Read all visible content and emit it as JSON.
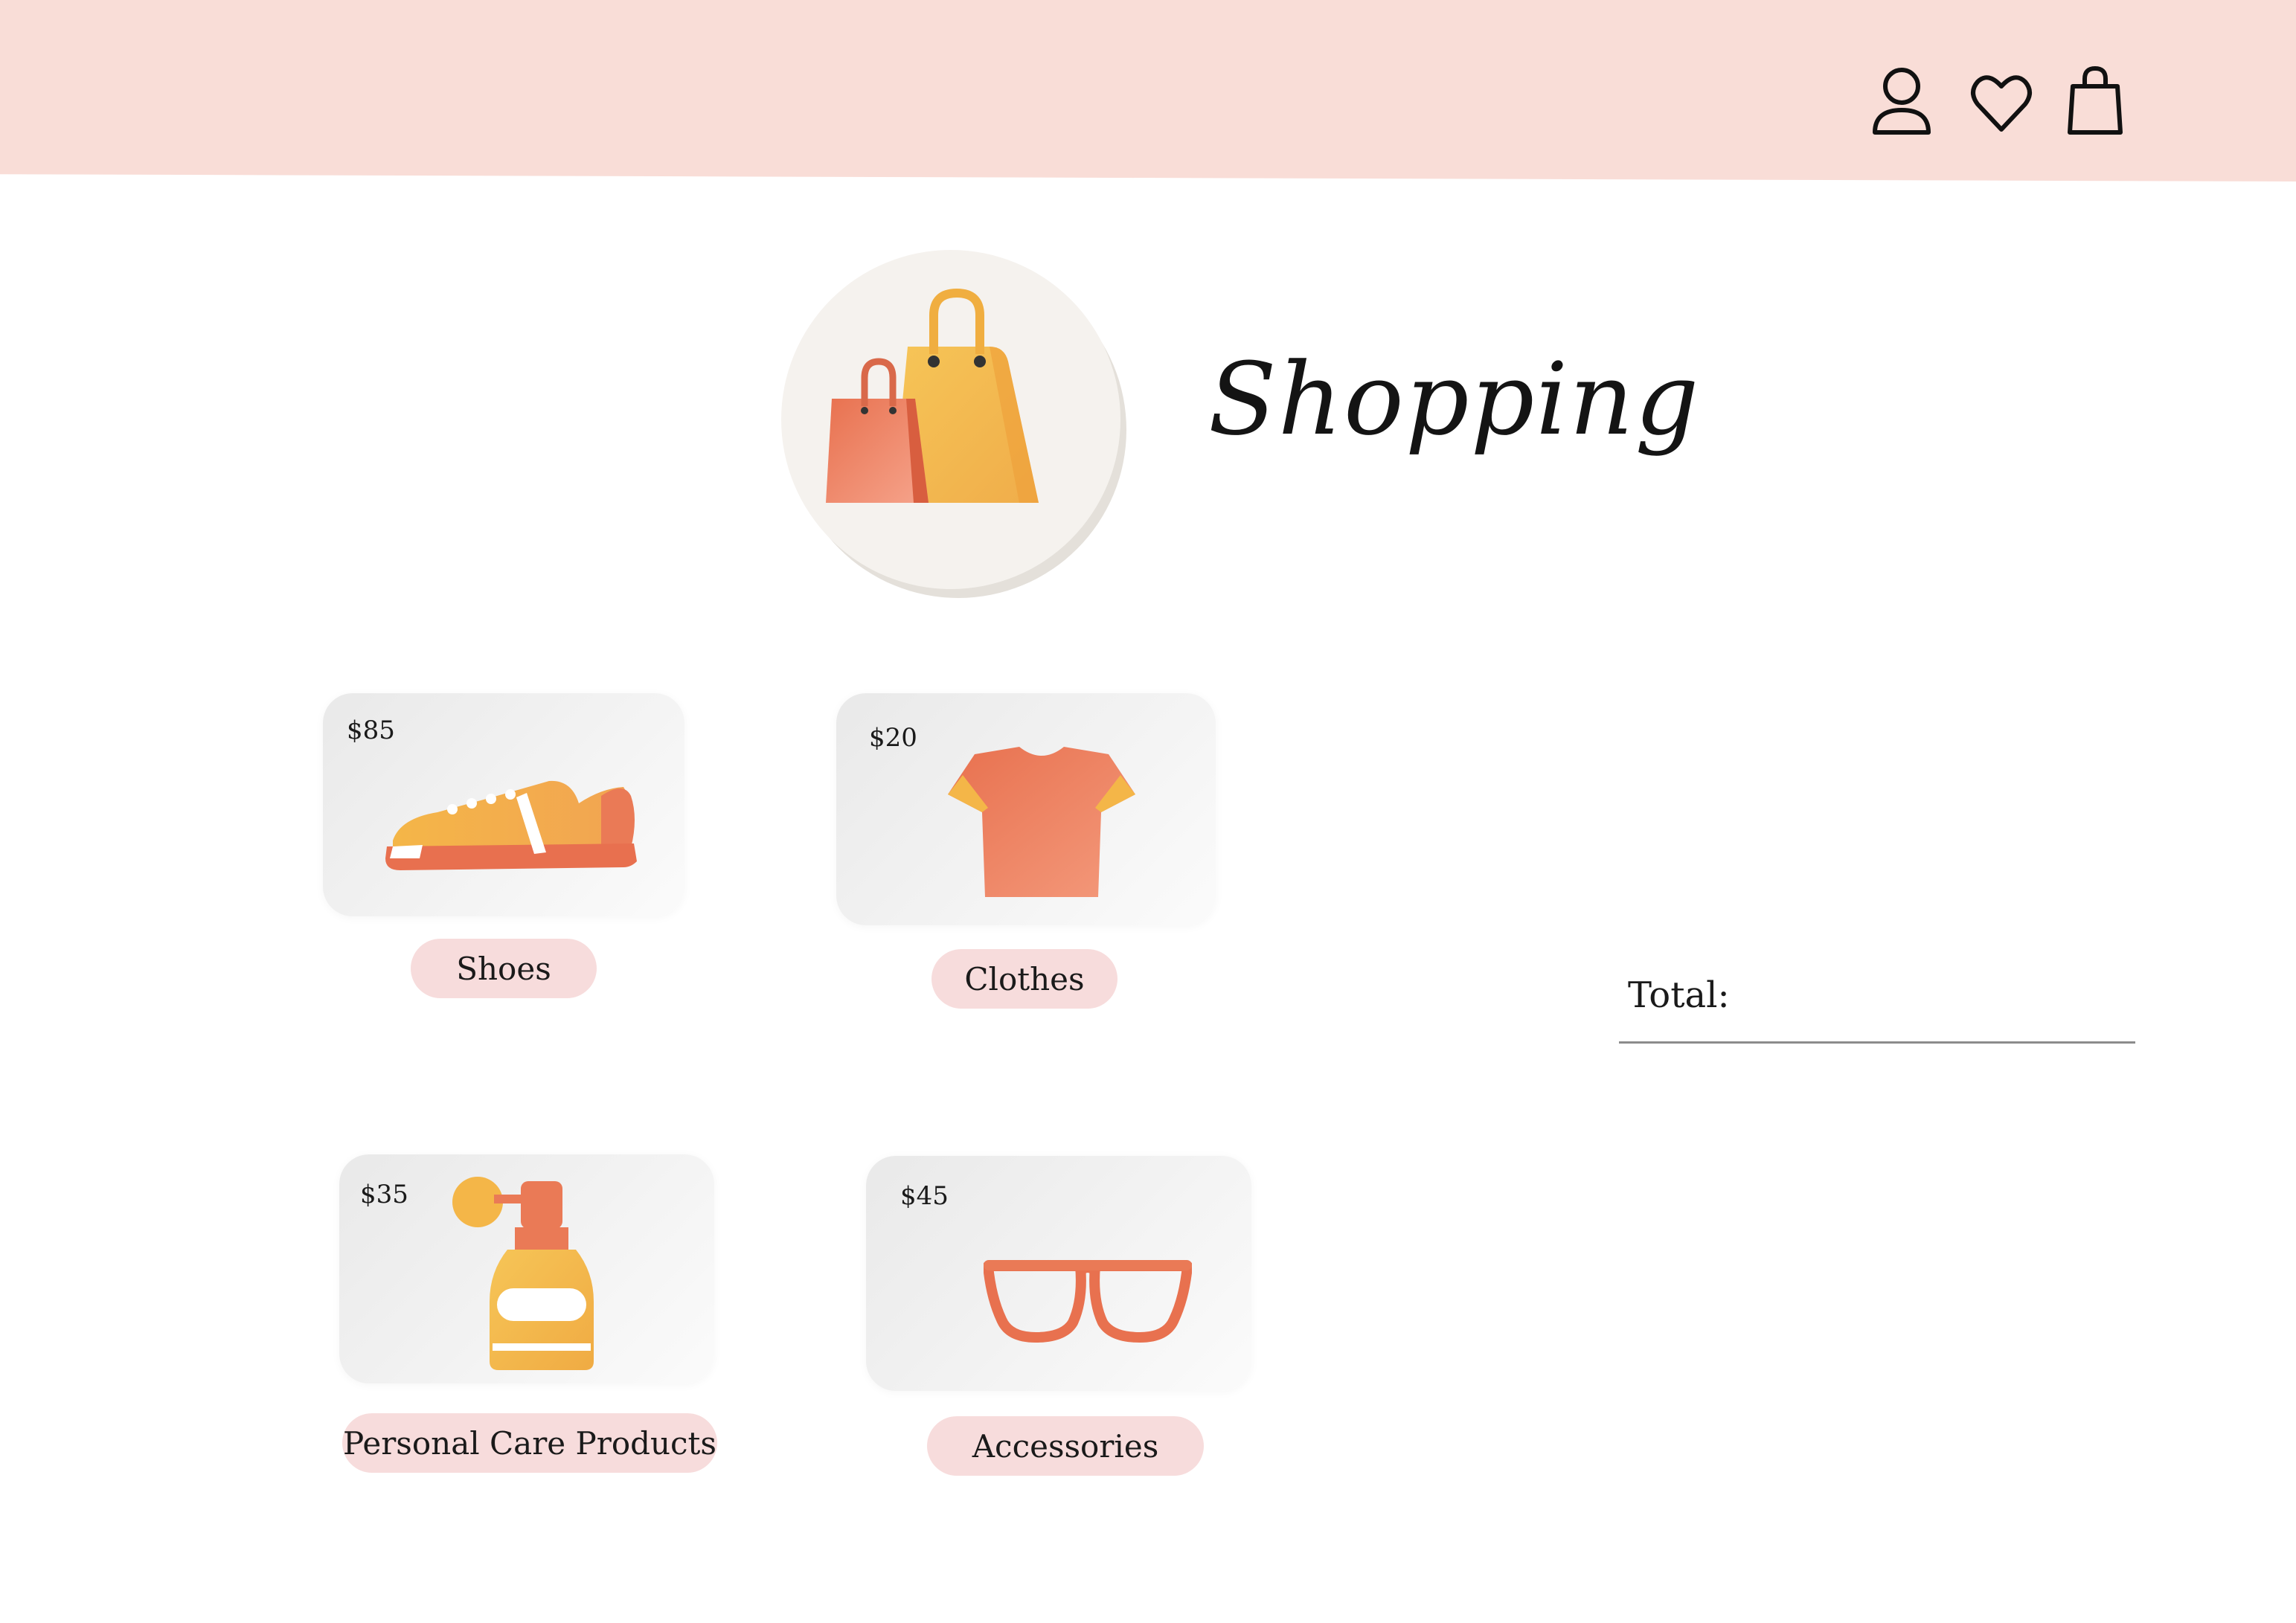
{
  "header": {
    "icons": [
      {
        "name": "user-icon"
      },
      {
        "name": "heart-icon"
      },
      {
        "name": "shopping-bag-icon"
      }
    ]
  },
  "hero": {
    "title": "Shopping",
    "logo_icon": "shopping-bags-icon"
  },
  "products": [
    {
      "price": "$85",
      "label": "Shoes",
      "icon": "sneaker-icon"
    },
    {
      "price": "$20",
      "label": "Clothes",
      "icon": "tshirt-icon"
    },
    {
      "price": "$35",
      "label": "Personal Care Products",
      "icon": "lotion-bottle-icon"
    },
    {
      "price": "$45",
      "label": "Accessories",
      "icon": "glasses-icon"
    }
  ],
  "summary": {
    "total_label": "Total:"
  },
  "colors": {
    "header_bg": "#f9ddd7",
    "pill_bg": "#f7dcdc",
    "accent_orange": "#ea7a56",
    "accent_yellow": "#f4b648"
  }
}
